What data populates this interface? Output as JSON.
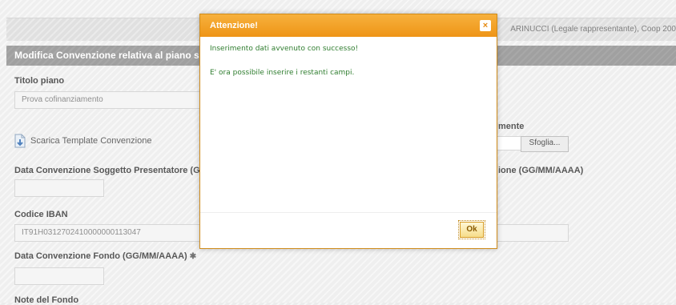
{
  "header": {
    "user_info": "ARINUCCI (Legale rappresentante), Coop 200"
  },
  "section": {
    "title": "Modifica Convenzione relativa al piano s"
  },
  "form": {
    "titolo_piano_label": "Titolo piano",
    "titolo_piano_value": "Prova cofinanziamento",
    "template_link": "Scarica Template Convenzione",
    "upload_label_fragment": "mente",
    "browse_button": "Sfoglia...",
    "data_conv_soggetto_label": "Data Convenzione Soggetto Presentatore (GG/",
    "data_conv_right_label_fragment": "ione (GG/MM/AAAA)",
    "iban_label": "Codice IBAN",
    "iban_value": "IT91H0312702410000000113047",
    "data_conv_fondo_label": "Data Convenzione Fondo (GG/MM/AAAA)",
    "required_mark": "✱",
    "note_fondo_label": "Note del Fondo"
  },
  "dialog": {
    "title": "Attenzione!",
    "message_1": "Inserimento dati avvenuto con successo!",
    "message_2": "E' ora possibile inserire i restanti campi.",
    "ok_button": "Ok",
    "close_symbol": "×"
  },
  "icons": {
    "close": "close-icon",
    "download": "download-icon"
  },
  "colors": {
    "dialog_header": "#f0a020",
    "success_text": "#2f7d2f",
    "section_header": "#8c8c8c"
  }
}
